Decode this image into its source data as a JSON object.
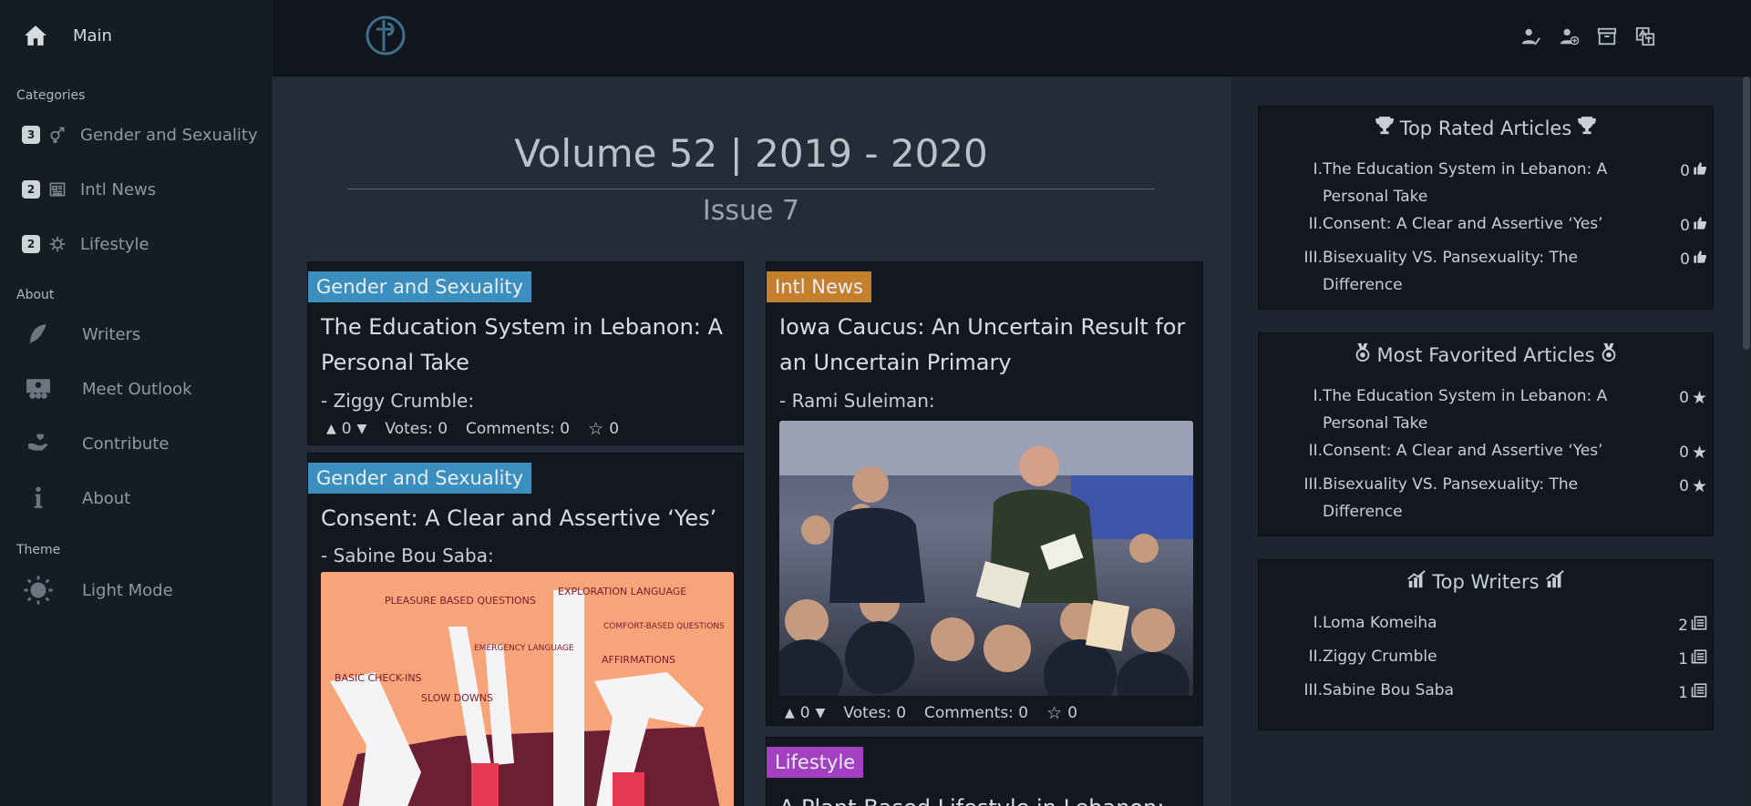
{
  "sidebar": {
    "main_label": "Main",
    "categories_heading": "Categories",
    "categories": [
      {
        "count": "3",
        "label": "Gender and Sexuality",
        "icon": "gender-icon"
      },
      {
        "count": "2",
        "label": "Intl News",
        "icon": "newspaper-icon"
      },
      {
        "count": "2",
        "label": "Lifestyle",
        "icon": "virus-icon"
      }
    ],
    "about_heading": "About",
    "about_items": [
      {
        "label": "Writers",
        "icon": "feather-icon"
      },
      {
        "label": "Meet Outlook",
        "icon": "team-icon"
      },
      {
        "label": "Contribute",
        "icon": "hand-heart-icon"
      },
      {
        "label": "About",
        "icon": "info-icon"
      }
    ],
    "theme_heading": "Theme",
    "theme_label": "Light Mode"
  },
  "header": {
    "icons": [
      "user-check-icon",
      "user-plus-icon",
      "archive-icon",
      "translate-icon"
    ]
  },
  "main": {
    "volume_title": "Volume 52 | 2019 - 2020",
    "issue_title": "Issue 7",
    "articles": [
      {
        "category": "Gender and Sexuality",
        "category_color": "#3a8fbf",
        "title": "The Education System in Lebanon: A Personal Take",
        "author": "- Ziggy Crumble:",
        "score": "0",
        "votes": "Votes: 0",
        "comments": "Comments: 0",
        "favorites": "0"
      },
      {
        "category": "Gender and Sexuality",
        "category_color": "#3a8fbf",
        "title": "Consent: A Clear and Assertive ‘Yes’",
        "author": "- Sabine Bou Saba:"
      },
      {
        "category": "Intl News",
        "category_color": "#c4802f",
        "title": "Iowa Caucus: An Uncertain Result for an Uncertain Primary",
        "author": "- Rami Suleiman:",
        "score": "0",
        "votes": "Votes: 0",
        "comments": "Comments: 0",
        "favorites": "0"
      },
      {
        "category": "Lifestyle",
        "category_color": "#a33fc0",
        "title": "A Plant-Based Lifestyle in Lebanon:"
      }
    ],
    "illustration_labels": [
      "PLEASURE BASED QUESTIONS",
      "EXPLORATION LANGUAGE",
      "COMFORT-BASED QUESTIONS",
      "EMERGENCY LANGUAGE",
      "BASIC CHECK-INS",
      "SLOW DOWNS",
      "AFFIRMATIONS"
    ]
  },
  "panels": {
    "top_rated": {
      "title": "Top Rated Articles",
      "items": [
        {
          "num": "I.",
          "text": "The Education System in Lebanon: A Personal Take",
          "value": "0"
        },
        {
          "num": "II.",
          "text": "Consent: A Clear and Assertive ‘Yes’",
          "value": "0"
        },
        {
          "num": "III.",
          "text": "Bisexuality VS. Pansexuality: The Difference",
          "value": "0"
        }
      ]
    },
    "most_favorited": {
      "title": "Most Favorited Articles",
      "items": [
        {
          "num": "I.",
          "text": "The Education System in Lebanon: A Personal Take",
          "value": "0"
        },
        {
          "num": "II.",
          "text": "Consent: A Clear and Assertive ‘Yes’",
          "value": "0"
        },
        {
          "num": "III.",
          "text": "Bisexuality VS. Pansexuality: The Difference",
          "value": "0"
        }
      ]
    },
    "top_writers": {
      "title": "Top Writers",
      "items": [
        {
          "num": "I.",
          "text": "Loma Komeiha",
          "value": "2"
        },
        {
          "num": "II.",
          "text": "Ziggy Crumble",
          "value": "1"
        },
        {
          "num": "III.",
          "text": "Sabine Bou Saba",
          "value": "1"
        }
      ]
    }
  }
}
